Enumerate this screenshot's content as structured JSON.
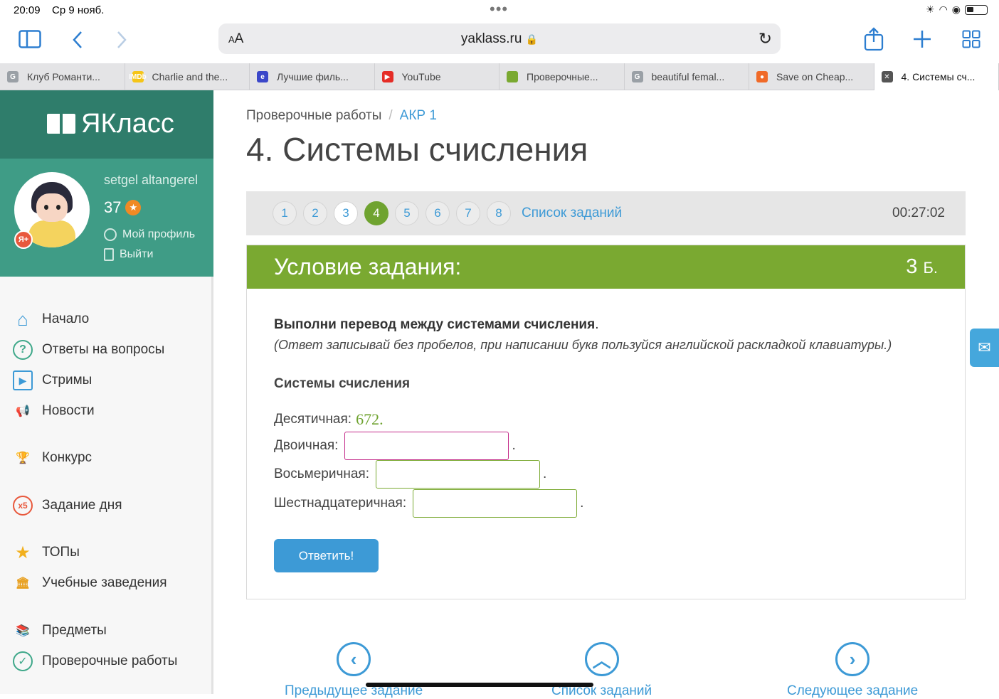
{
  "status": {
    "time": "20:09",
    "date": "Ср 9 нояб."
  },
  "browser": {
    "url": "yaklass.ru",
    "aa_label": "AA",
    "tabs": [
      {
        "label": "Клуб Романти...",
        "fav_color": "#9aa0a6",
        "fav_text": "G"
      },
      {
        "label": "Charlie and the...",
        "fav_color": "#f5c518",
        "fav_text": "IMDb"
      },
      {
        "label": "Лучшие филь...",
        "fav_color": "#3b47c9",
        "fav_text": "e"
      },
      {
        "label": "YouTube",
        "fav_color": "#e52d27",
        "fav_text": "▶"
      },
      {
        "label": "Проверочные...",
        "fav_color": "#7aa931",
        "fav_text": ""
      },
      {
        "label": "beautiful femal...",
        "fav_color": "#9aa0a6",
        "fav_text": "G"
      },
      {
        "label": "Save on Cheap...",
        "fav_color": "#f06a28",
        "fav_text": "●"
      },
      {
        "label": "4. Системы сч...",
        "fav_color": "#555",
        "fav_text": "✕"
      }
    ]
  },
  "site": {
    "logo": "ЯКласс"
  },
  "profile": {
    "username": "setgel altangerel",
    "points": "37",
    "badge": "Я+",
    "my_profile": "Мой профиль",
    "logout": "Выйти"
  },
  "nav": {
    "items": [
      {
        "label": "Начало",
        "icon": "home-icon"
      },
      {
        "label": "Ответы на вопросы",
        "icon": "question-icon"
      },
      {
        "label": "Стримы",
        "icon": "play-icon"
      },
      {
        "label": "Новости",
        "icon": "megaphone-icon"
      },
      {
        "label": "Конкурс",
        "icon": "trophy-icon"
      },
      {
        "label": "Задание дня",
        "icon": "x5-icon"
      },
      {
        "label": "ТОПы",
        "icon": "star-icon"
      },
      {
        "label": "Учебные заведения",
        "icon": "school-icon"
      },
      {
        "label": "Предметы",
        "icon": "books-icon"
      },
      {
        "label": "Проверочные работы",
        "icon": "check-icon"
      }
    ]
  },
  "breadcrumb": {
    "parent": "Проверочные работы",
    "separator": "/",
    "current": "АКР 1"
  },
  "page_title": "4. Системы счисления",
  "question_nav": {
    "numbers": [
      "1",
      "2",
      "3",
      "4",
      "5",
      "6",
      "7",
      "8"
    ],
    "current": "4",
    "completed": [
      "3"
    ],
    "list_label": "Список заданий",
    "timer": "00:27:02"
  },
  "task": {
    "header": "Условие задания:",
    "points_value": "3",
    "points_unit": "Б.",
    "instruction": "Выполни перевод между системами счисления",
    "instruction_end": ".",
    "hint": "(Ответ записывай без пробелов, при написании букв пользуйся английской раскладкой клавиатуры.)",
    "section_title": "Системы счисления",
    "decimal_label": "Десятичная:",
    "decimal_value": "672",
    "decimal_end": ".",
    "binary_label": "Двоичная:",
    "binary_value": "",
    "octal_label": "Восьмеричная:",
    "octal_value": "",
    "hex_label": "Шестнадцатеричная:",
    "hex_value": "",
    "dot": ".",
    "submit": "Ответить!"
  },
  "bottom_nav": {
    "prev": "Предыдущее задание",
    "list": "Список заданий",
    "next": "Следующее задание"
  }
}
